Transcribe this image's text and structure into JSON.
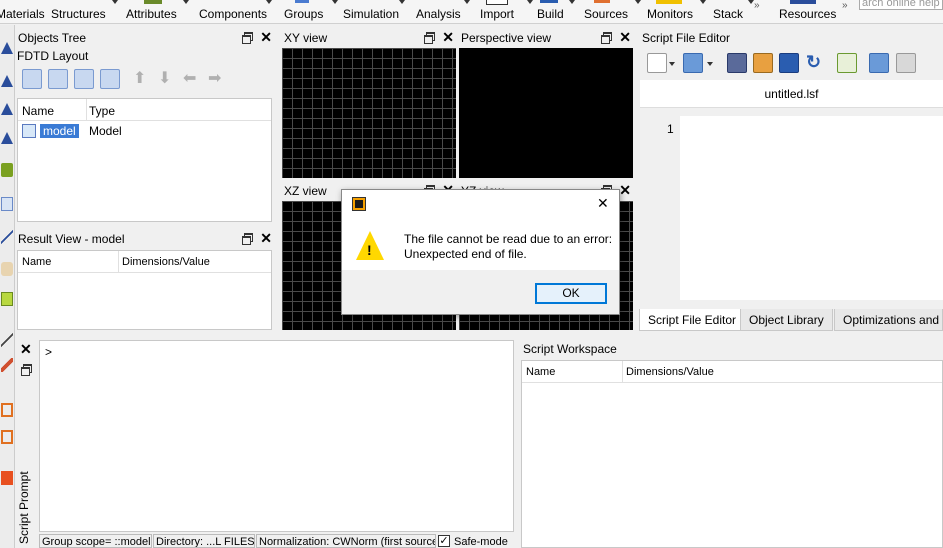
{
  "ribbon": {
    "items": [
      "Materials",
      "Structures",
      "Attributes",
      "Components",
      "Groups",
      "Simulation",
      "Analysis",
      "Import",
      "Build",
      "Sources",
      "Monitors",
      "Stack",
      "Resources"
    ],
    "overflow_glyph": "»",
    "search_placeholder": "arch online help"
  },
  "objects_tree": {
    "title": "Objects Tree",
    "layout_label": "FDTD Layout",
    "columns": [
      "Name",
      "Type"
    ],
    "rows": [
      {
        "name": "model",
        "type": "Model"
      }
    ]
  },
  "result_view": {
    "title": "Result View - model",
    "columns": [
      "Name",
      "Dimensions/Value"
    ]
  },
  "views": {
    "xy": "XY view",
    "perspective": "Perspective view",
    "xz": "XZ view",
    "yz": "YZ view"
  },
  "script_editor": {
    "title": "Script File Editor",
    "file_tab": "untitled.lsf",
    "line_number": "1",
    "tabs": [
      "Script File Editor",
      "Object Library",
      "Optimizations and Sw"
    ]
  },
  "script_prompt": {
    "title": "Script Prompt",
    "prompt": ">"
  },
  "script_workspace": {
    "title": "Script Workspace",
    "columns": [
      "Name",
      "Dimensions/Value"
    ]
  },
  "status_bar": {
    "group_scope": "Group scope= ::model",
    "directory": "Directory: ...L FILES",
    "normalization": "Normalization: CWNorm (first source)",
    "safe_mode": "Safe-mode"
  },
  "dialog": {
    "message_line1": "The file cannot be read due to an error:",
    "message_line2": "Unexpected end of file.",
    "ok_label": "OK",
    "close_glyph": "✕",
    "warning_glyph": "!"
  },
  "colors": {
    "accent_blue": "#0078d7",
    "selection_blue": "#3a7bd5",
    "warning_yellow": "#ffd800",
    "app_icon_orange": "#f5a000"
  }
}
